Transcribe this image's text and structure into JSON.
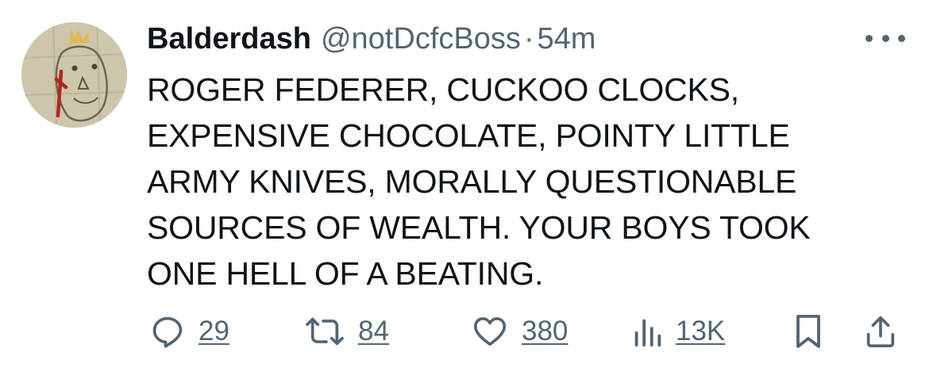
{
  "author": {
    "display_name": "Balderdash",
    "handle": "@notDcfcBoss",
    "separator": "·",
    "time_ago": "54m"
  },
  "tweet": {
    "text": "ROGER FEDERER, CUCKOO CLOCKS,\nEXPENSIVE CHOCOLATE, POINTY LITTLE\nARMY KNIVES, MORALLY QUESTIONABLE\nSOURCES OF WEALTH. YOUR BOYS TOOK\nONE HELL OF A BEATING."
  },
  "actions": {
    "replies": "29",
    "retweets": "84",
    "likes": "380",
    "views": "13K"
  },
  "icons": {
    "more": "more-horizontal-icon",
    "reply": "reply-icon",
    "retweet": "retweet-icon",
    "like": "heart-icon",
    "views": "views-icon",
    "bookmark": "bookmark-icon",
    "share": "share-icon"
  },
  "colors": {
    "text_primary": "#0f1419",
    "text_secondary": "#536471",
    "background": "#ffffff"
  }
}
